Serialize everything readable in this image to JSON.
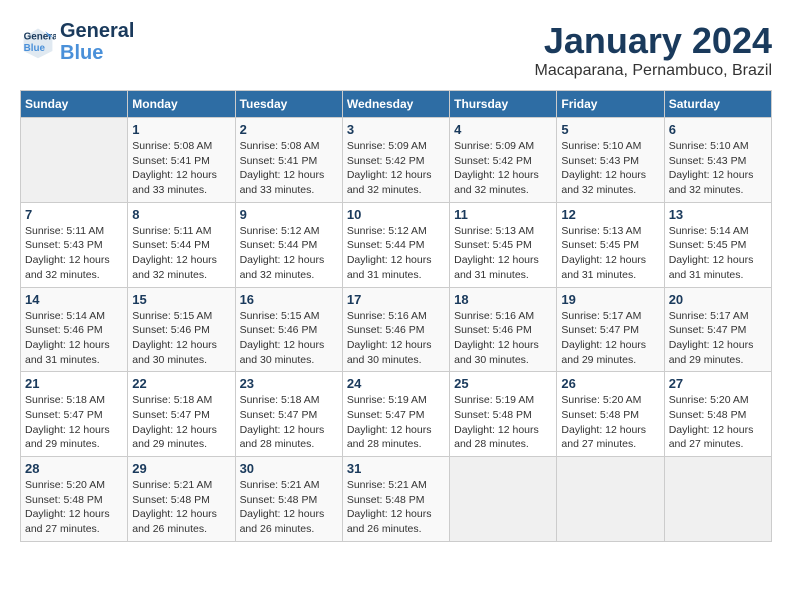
{
  "header": {
    "logo_line1": "General",
    "logo_line2": "Blue",
    "title": "January 2024",
    "subtitle": "Macaparana, Pernambuco, Brazil"
  },
  "weekdays": [
    "Sunday",
    "Monday",
    "Tuesday",
    "Wednesday",
    "Thursday",
    "Friday",
    "Saturday"
  ],
  "weeks": [
    [
      {
        "day": "",
        "sunrise": "",
        "sunset": "",
        "daylight": ""
      },
      {
        "day": "1",
        "sunrise": "5:08 AM",
        "sunset": "5:41 PM",
        "daylight": "12 hours and 33 minutes."
      },
      {
        "day": "2",
        "sunrise": "5:08 AM",
        "sunset": "5:41 PM",
        "daylight": "12 hours and 33 minutes."
      },
      {
        "day": "3",
        "sunrise": "5:09 AM",
        "sunset": "5:42 PM",
        "daylight": "12 hours and 32 minutes."
      },
      {
        "day": "4",
        "sunrise": "5:09 AM",
        "sunset": "5:42 PM",
        "daylight": "12 hours and 32 minutes."
      },
      {
        "day": "5",
        "sunrise": "5:10 AM",
        "sunset": "5:43 PM",
        "daylight": "12 hours and 32 minutes."
      },
      {
        "day": "6",
        "sunrise": "5:10 AM",
        "sunset": "5:43 PM",
        "daylight": "12 hours and 32 minutes."
      }
    ],
    [
      {
        "day": "7",
        "sunrise": "5:11 AM",
        "sunset": "5:43 PM",
        "daylight": "12 hours and 32 minutes."
      },
      {
        "day": "8",
        "sunrise": "5:11 AM",
        "sunset": "5:44 PM",
        "daylight": "12 hours and 32 minutes."
      },
      {
        "day": "9",
        "sunrise": "5:12 AM",
        "sunset": "5:44 PM",
        "daylight": "12 hours and 32 minutes."
      },
      {
        "day": "10",
        "sunrise": "5:12 AM",
        "sunset": "5:44 PM",
        "daylight": "12 hours and 31 minutes."
      },
      {
        "day": "11",
        "sunrise": "5:13 AM",
        "sunset": "5:45 PM",
        "daylight": "12 hours and 31 minutes."
      },
      {
        "day": "12",
        "sunrise": "5:13 AM",
        "sunset": "5:45 PM",
        "daylight": "12 hours and 31 minutes."
      },
      {
        "day": "13",
        "sunrise": "5:14 AM",
        "sunset": "5:45 PM",
        "daylight": "12 hours and 31 minutes."
      }
    ],
    [
      {
        "day": "14",
        "sunrise": "5:14 AM",
        "sunset": "5:46 PM",
        "daylight": "12 hours and 31 minutes."
      },
      {
        "day": "15",
        "sunrise": "5:15 AM",
        "sunset": "5:46 PM",
        "daylight": "12 hours and 30 minutes."
      },
      {
        "day": "16",
        "sunrise": "5:15 AM",
        "sunset": "5:46 PM",
        "daylight": "12 hours and 30 minutes."
      },
      {
        "day": "17",
        "sunrise": "5:16 AM",
        "sunset": "5:46 PM",
        "daylight": "12 hours and 30 minutes."
      },
      {
        "day": "18",
        "sunrise": "5:16 AM",
        "sunset": "5:46 PM",
        "daylight": "12 hours and 30 minutes."
      },
      {
        "day": "19",
        "sunrise": "5:17 AM",
        "sunset": "5:47 PM",
        "daylight": "12 hours and 29 minutes."
      },
      {
        "day": "20",
        "sunrise": "5:17 AM",
        "sunset": "5:47 PM",
        "daylight": "12 hours and 29 minutes."
      }
    ],
    [
      {
        "day": "21",
        "sunrise": "5:18 AM",
        "sunset": "5:47 PM",
        "daylight": "12 hours and 29 minutes."
      },
      {
        "day": "22",
        "sunrise": "5:18 AM",
        "sunset": "5:47 PM",
        "daylight": "12 hours and 29 minutes."
      },
      {
        "day": "23",
        "sunrise": "5:18 AM",
        "sunset": "5:47 PM",
        "daylight": "12 hours and 28 minutes."
      },
      {
        "day": "24",
        "sunrise": "5:19 AM",
        "sunset": "5:47 PM",
        "daylight": "12 hours and 28 minutes."
      },
      {
        "day": "25",
        "sunrise": "5:19 AM",
        "sunset": "5:48 PM",
        "daylight": "12 hours and 28 minutes."
      },
      {
        "day": "26",
        "sunrise": "5:20 AM",
        "sunset": "5:48 PM",
        "daylight": "12 hours and 27 minutes."
      },
      {
        "day": "27",
        "sunrise": "5:20 AM",
        "sunset": "5:48 PM",
        "daylight": "12 hours and 27 minutes."
      }
    ],
    [
      {
        "day": "28",
        "sunrise": "5:20 AM",
        "sunset": "5:48 PM",
        "daylight": "12 hours and 27 minutes."
      },
      {
        "day": "29",
        "sunrise": "5:21 AM",
        "sunset": "5:48 PM",
        "daylight": "12 hours and 26 minutes."
      },
      {
        "day": "30",
        "sunrise": "5:21 AM",
        "sunset": "5:48 PM",
        "daylight": "12 hours and 26 minutes."
      },
      {
        "day": "31",
        "sunrise": "5:21 AM",
        "sunset": "5:48 PM",
        "daylight": "12 hours and 26 minutes."
      },
      {
        "day": "",
        "sunrise": "",
        "sunset": "",
        "daylight": ""
      },
      {
        "day": "",
        "sunrise": "",
        "sunset": "",
        "daylight": ""
      },
      {
        "day": "",
        "sunrise": "",
        "sunset": "",
        "daylight": ""
      }
    ]
  ]
}
